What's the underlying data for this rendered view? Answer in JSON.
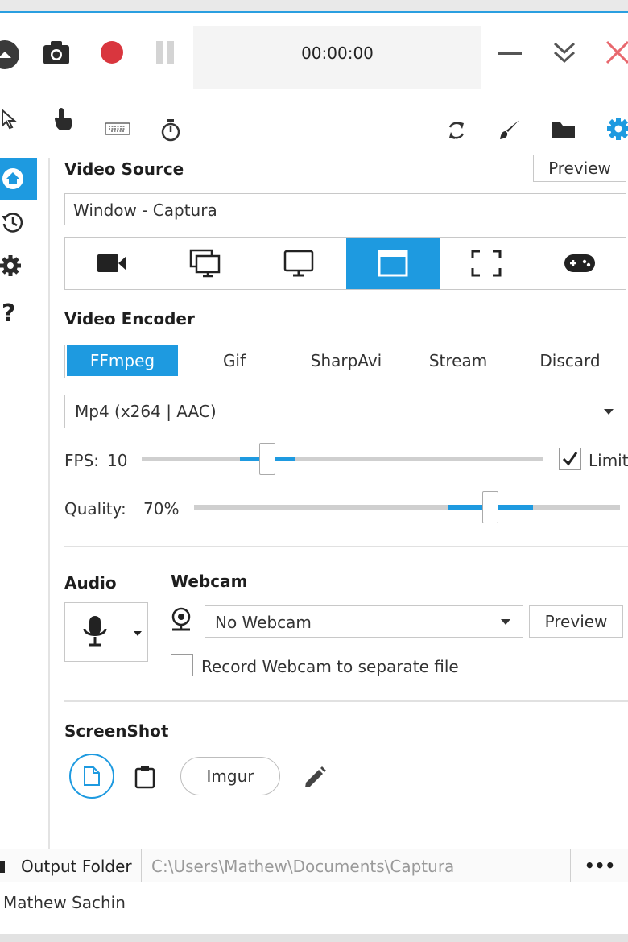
{
  "toolbar": {
    "timer": "00:00:00"
  },
  "video_source": {
    "heading": "Video Source",
    "preview_label": "Preview",
    "selected_source": "Window  -  Captura",
    "sources": [
      "video-camera",
      "multi-screen",
      "monitor",
      "window",
      "region-select",
      "game-controller"
    ],
    "active_index": 3
  },
  "video_encoder": {
    "heading": "Video Encoder",
    "tabs": [
      "FFmpeg",
      "Gif",
      "SharpAvi",
      "Stream",
      "Discard"
    ],
    "active_index": 0,
    "format": "Mp4 (x264 | AAC)"
  },
  "fps": {
    "label": "FPS:",
    "value": "10",
    "limit_label": "Limit",
    "limit_checked": true
  },
  "quality": {
    "label": "Quality:",
    "value": "70%",
    "level": 0.7
  },
  "audio": {
    "heading": "Audio"
  },
  "webcam": {
    "heading": "Webcam",
    "selected": "No Webcam",
    "preview_label": "Preview",
    "separate_file_label": "Record Webcam to separate file",
    "separate_file_checked": false
  },
  "screenshot": {
    "heading": "ScreenShot",
    "imgur_label": "Imgur"
  },
  "output": {
    "label": "Output Folder",
    "path": "C:\\Users\\Mathew\\Documents\\Captura",
    "more_label": "•••"
  },
  "status": {
    "author": "Mathew Sachin"
  },
  "colors": {
    "accent": "#1e9ae0",
    "record": "#d9363e",
    "close": "#e8686e"
  }
}
